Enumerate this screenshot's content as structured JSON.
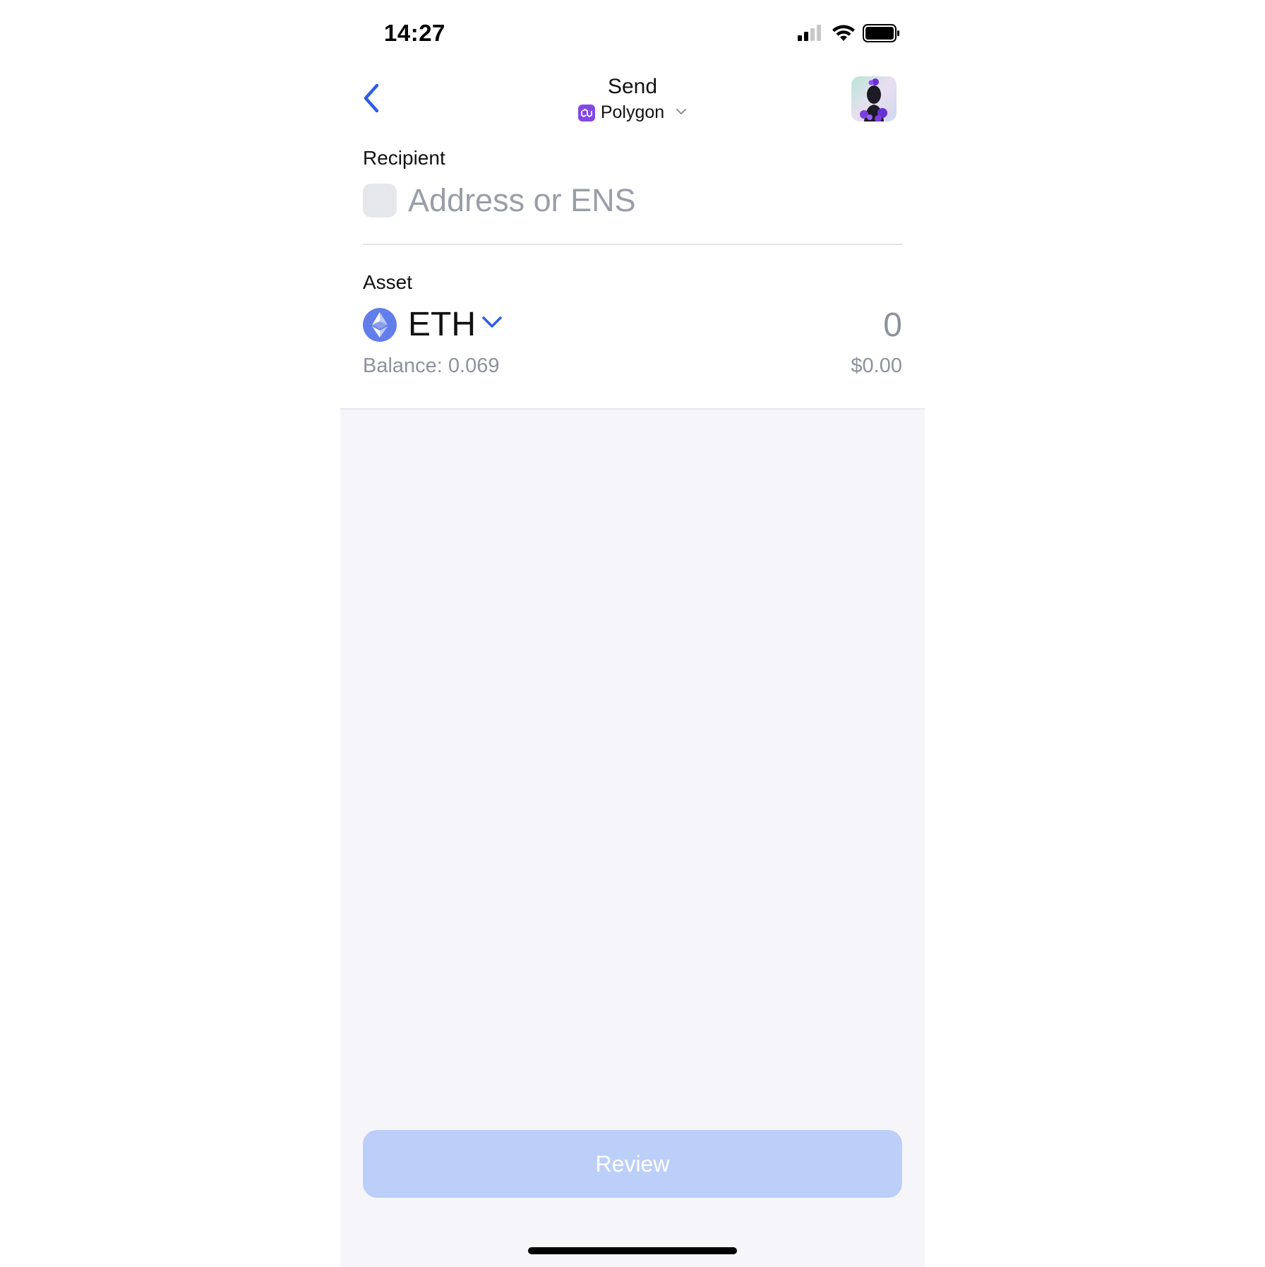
{
  "status_bar": {
    "time": "14:27",
    "signal_icon": "cellular-signal-icon",
    "wifi_icon": "wifi-icon",
    "battery_icon": "battery-icon"
  },
  "header": {
    "title": "Send",
    "network": "Polygon",
    "back_icon": "chevron-left-icon",
    "network_icon": "polygon-icon",
    "network_chevron_icon": "chevron-down-icon",
    "avatar": "wallet-avatar"
  },
  "recipient": {
    "label": "Recipient",
    "placeholder": "Address or ENS"
  },
  "asset": {
    "label": "Asset",
    "symbol": "ETH",
    "icon": "ethereum-icon",
    "amount_placeholder": "0",
    "balance": "Balance: 0.069",
    "fiat_value": "$0.00"
  },
  "footer": {
    "review_label": "Review"
  },
  "colors": {
    "accent": "#2d5ce6",
    "review_disabled": "#bccff8",
    "polygon": "#8247e5",
    "ethereum": "#627eea",
    "muted_text": "#8e929c",
    "panel_bg": "#f6f6fa"
  }
}
